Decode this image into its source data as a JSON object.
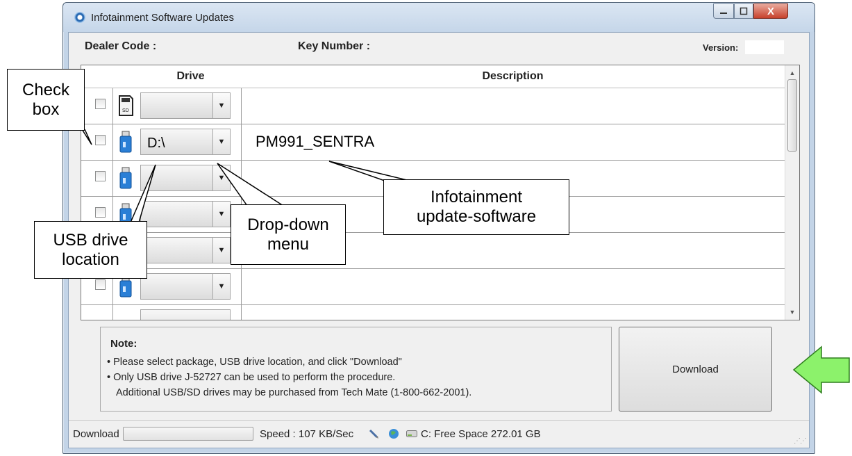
{
  "window": {
    "title": "Infotainment Software Updates",
    "close_glyph": "X"
  },
  "header": {
    "dealer_code_label": "Dealer Code :",
    "key_number_label": "Key Number :",
    "version_label": "Version:"
  },
  "grid": {
    "columns": {
      "drive": "Drive",
      "description": "Description"
    },
    "rows": [
      {
        "icon": "sd-card-icon",
        "drive": "",
        "description": ""
      },
      {
        "icon": "usb-drive-icon",
        "drive": "D:\\",
        "description": "PM991_SENTRA"
      },
      {
        "icon": "usb-drive-icon",
        "drive": "",
        "description": ""
      },
      {
        "icon": "usb-drive-icon",
        "drive": "",
        "description": ""
      },
      {
        "icon": "usb-drive-icon",
        "drive": "",
        "description": ""
      },
      {
        "icon": "usb-drive-icon",
        "drive": "",
        "description": ""
      }
    ]
  },
  "note": {
    "title": "Note:",
    "lines": [
      "• Please select package, USB drive location, and click \"Download\"",
      "• Only USB drive J-52727 can be used to perform the procedure.",
      "Additional USB/SD drives may be purchased from Tech Mate (1-800-662-2001)."
    ]
  },
  "download_button": "Download",
  "status_bar": {
    "download_label": "Download :",
    "speed": "Speed : 107 KB/Sec",
    "free_space": "C: Free Space 272.01 GB"
  },
  "callouts": {
    "check_box": [
      "Check",
      "box"
    ],
    "usb_drive_location": [
      "USB drive",
      "location"
    ],
    "drop_down_menu": [
      "Drop-down",
      "menu"
    ],
    "infotainment_update_software": [
      "Infotainment",
      "update-software"
    ]
  },
  "colors": {
    "arrow_fill": "#8cf26b",
    "arrow_stroke": "#2f7d1e",
    "window_frame": "#c3d4e7"
  }
}
